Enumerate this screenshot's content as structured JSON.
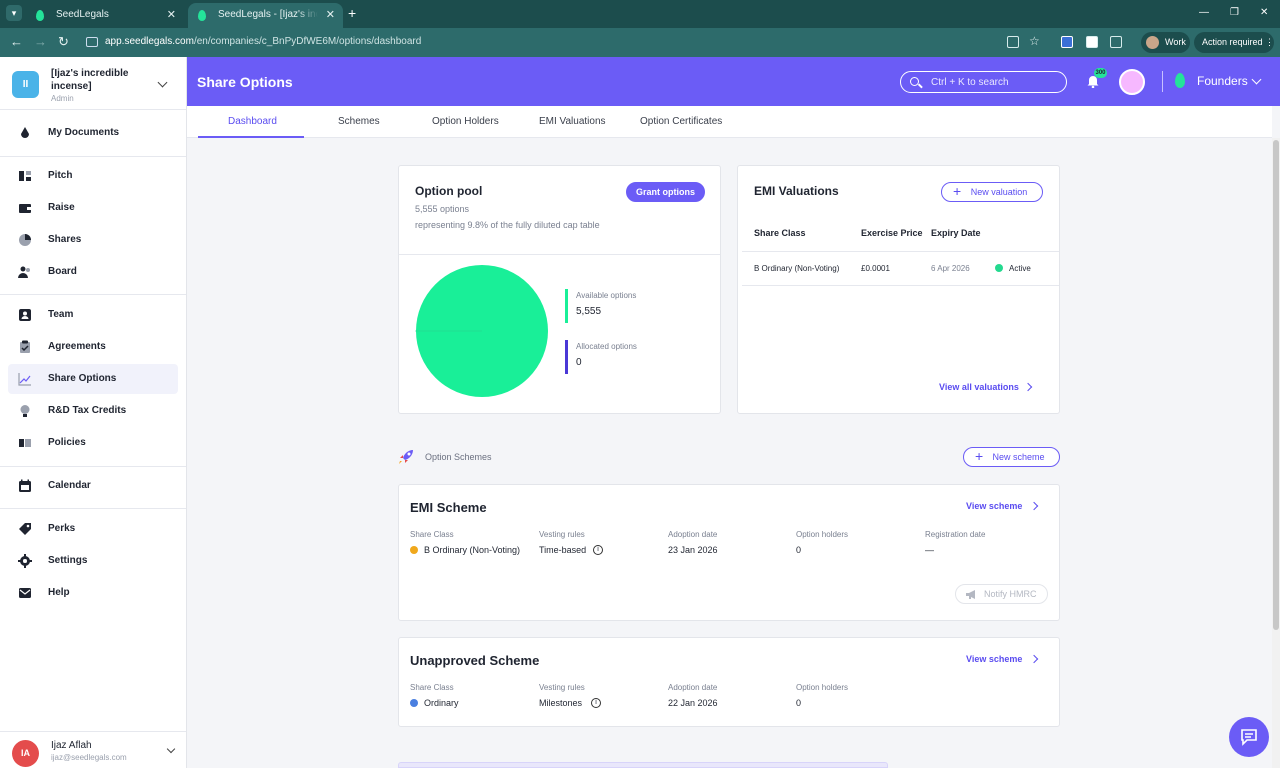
{
  "browser": {
    "tabs": [
      {
        "title": "SeedLegals"
      },
      {
        "title": "SeedLegals - [Ijaz's incredible incense]"
      }
    ],
    "url_host": "app.seedlegals.com",
    "url_path": "/en/companies/c_BnPyDfWE6M/options/dashboard",
    "profile_label": "Work",
    "action_label": "Action required"
  },
  "sidebar": {
    "company_initials": "II",
    "company_name": "[Ijaz's incredible incense]",
    "company_role": "Admin",
    "items": [
      {
        "label": "My Documents",
        "icon": "documents-icon"
      },
      {
        "label": "Pitch",
        "icon": "pitch-icon"
      },
      {
        "label": "Raise",
        "icon": "raise-icon"
      },
      {
        "label": "Shares",
        "icon": "shares-icon"
      },
      {
        "label": "Board",
        "icon": "board-icon"
      },
      {
        "label": "Team",
        "icon": "team-icon"
      },
      {
        "label": "Agreements",
        "icon": "agreements-icon"
      },
      {
        "label": "Share Options",
        "icon": "share-options-icon"
      },
      {
        "label": "R&D Tax Credits",
        "icon": "lightbulb-icon"
      },
      {
        "label": "Policies",
        "icon": "policies-icon"
      },
      {
        "label": "Calendar",
        "icon": "calendar-icon"
      },
      {
        "label": "Perks",
        "icon": "perks-icon"
      },
      {
        "label": "Settings",
        "icon": "gear-icon"
      },
      {
        "label": "Help",
        "icon": "help-icon"
      }
    ],
    "user_initials": "IA",
    "user_name": "Ijaz Aflah",
    "user_email": "ijaz@seedlegals.com"
  },
  "header": {
    "title": "Share Options",
    "search_placeholder": "Ctrl + K to search",
    "notification_count": "300",
    "workspace": "Founders"
  },
  "tabs": [
    "Dashboard",
    "Schemes",
    "Option Holders",
    "EMI Valuations",
    "Option Certificates"
  ],
  "option_pool": {
    "title": "Option pool",
    "count_text": "5,555 options",
    "representing": "representing 9.8% of the fully diluted cap table",
    "grant_label": "Grant options",
    "available_label": "Available options",
    "available_value": "5,555",
    "allocated_label": "Allocated options",
    "allocated_value": "0",
    "colors": {
      "available": "#19ef98",
      "allocated": "#4a38d6"
    }
  },
  "emi_valuations": {
    "title": "EMI Valuations",
    "new_label": "New valuation",
    "columns": [
      "Share Class",
      "Exercise Price",
      "Expiry Date"
    ],
    "rows": [
      {
        "share_class": "B Ordinary (Non-Voting)",
        "price": "£0.0001",
        "expiry": "6 Apr 2026",
        "status": "Active"
      }
    ],
    "view_all": "View all valuations"
  },
  "option_schemes": {
    "title": "Option Schemes",
    "new_label": "New scheme",
    "labels": {
      "share_class": "Share Class",
      "vesting": "Vesting rules",
      "adoption": "Adoption date",
      "holders": "Option holders",
      "registration": "Registration date"
    },
    "view_label": "View scheme",
    "emi": {
      "name": "EMI Scheme",
      "share_class": "B Ordinary (Non-Voting)",
      "vesting": "Time-based",
      "adoption": "23 Jan 2026",
      "holders": "0",
      "registration": "—",
      "notify_label": "Notify HMRC"
    },
    "unapproved": {
      "name": "Unapproved Scheme",
      "share_class": "Ordinary",
      "vesting": "Milestones",
      "adoption": "22 Jan 2026",
      "holders": "0"
    }
  }
}
